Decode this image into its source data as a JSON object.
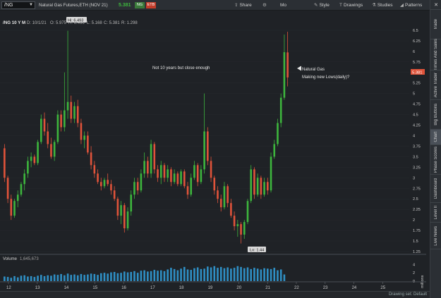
{
  "toolbar": {
    "symbol": "/NG",
    "description": "Natural Gas Futures,ETH (NOV 21)",
    "last_price": "5.381",
    "badge_ng": "NG",
    "badge_etb": "ETB",
    "buttons": [
      "Share",
      "Mo",
      "Style",
      "Drawings",
      "Studies",
      "Patterns"
    ]
  },
  "info": {
    "period": "/NG 10 Y M",
    "date": "D: 10/1/21",
    "open": "O: 5.975",
    "high": "H: 6.466",
    "low": "L: 5.168",
    "close": "C: 5.381",
    "range": "R: 1.298"
  },
  "annotations": {
    "hi_label": "Hi: 6.493",
    "lo_label": "Lo: 1.44",
    "note": "Not 10 years but close enough",
    "arrow_line1": "Natural Gas",
    "arrow_line2": "Making new Lows(daily)?",
    "price_tag": "5.381"
  },
  "price_axis": [
    "6.5",
    "6.25",
    "6",
    "5.75",
    "5.5",
    "5.25",
    "5",
    "4.75",
    "4.5",
    "4.25",
    "4",
    "3.75",
    "3.5",
    "3.25",
    "3",
    "2.75",
    "2.5",
    "2.25",
    "2",
    "1.75",
    "1.5",
    "1.25"
  ],
  "volume_panel": {
    "label": "Volume",
    "value": "1,645,673",
    "axis": [
      "4",
      "2",
      "0"
    ],
    "unit": "millions"
  },
  "time_axis": [
    "12",
    "13",
    "14",
    "15",
    "16",
    "17",
    "18",
    "19",
    "20",
    "21",
    "22",
    "23",
    "24",
    "25"
  ],
  "side_tabs": [
    "Trade",
    "Times And Sales",
    "Active Trader",
    "Big Buttons",
    "Chart",
    "Phase Scores",
    "Dashboard",
    "Level II",
    "Live News"
  ],
  "bottom": {
    "drawing_set": "Drawing set: Default"
  },
  "colors": {
    "up": "#3db53d",
    "down": "#e0533a",
    "background": "#1f2226",
    "price_tag": "#e0533a",
    "last_price": "#3db53d"
  },
  "chart_data": {
    "type": "candlestick",
    "price_range": [
      1.25,
      6.6
    ],
    "x_labels": [
      "12",
      "13",
      "14",
      "15",
      "16",
      "17",
      "18",
      "19",
      "20",
      "21",
      "22",
      "23",
      "24",
      "25"
    ],
    "bars": [
      {
        "o": 3.7,
        "h": 3.8,
        "l": 2.9,
        "c": 3.0
      },
      {
        "o": 3.0,
        "h": 3.05,
        "l": 2.4,
        "c": 2.5
      },
      {
        "o": 2.5,
        "h": 2.6,
        "l": 2.0,
        "c": 2.1
      },
      {
        "o": 2.1,
        "h": 2.5,
        "l": 2.05,
        "c": 2.45
      },
      {
        "o": 2.45,
        "h": 2.7,
        "l": 2.3,
        "c": 2.6
      },
      {
        "o": 2.6,
        "h": 2.9,
        "l": 2.55,
        "c": 2.85
      },
      {
        "o": 2.85,
        "h": 3.2,
        "l": 2.7,
        "c": 3.1
      },
      {
        "o": 3.1,
        "h": 3.5,
        "l": 3.0,
        "c": 3.4
      },
      {
        "o": 3.4,
        "h": 3.6,
        "l": 3.25,
        "c": 3.5
      },
      {
        "o": 3.5,
        "h": 3.55,
        "l": 3.3,
        "c": 3.35
      },
      {
        "o": 3.35,
        "h": 3.9,
        "l": 3.3,
        "c": 3.85
      },
      {
        "o": 3.85,
        "h": 4.5,
        "l": 3.8,
        "c": 4.4
      },
      {
        "o": 4.4,
        "h": 4.55,
        "l": 4.0,
        "c": 4.1
      },
      {
        "o": 4.1,
        "h": 4.3,
        "l": 3.7,
        "c": 3.8
      },
      {
        "o": 3.8,
        "h": 3.95,
        "l": 3.45,
        "c": 3.5
      },
      {
        "o": 3.5,
        "h": 3.9,
        "l": 3.4,
        "c": 3.85
      },
      {
        "o": 3.85,
        "h": 4.6,
        "l": 3.8,
        "c": 4.5
      },
      {
        "o": 4.5,
        "h": 4.6,
        "l": 4.1,
        "c": 4.2
      },
      {
        "o": 4.2,
        "h": 5.5,
        "l": 4.1,
        "c": 4.6
      },
      {
        "o": 4.6,
        "h": 6.49,
        "l": 4.4,
        "c": 4.8
      },
      {
        "o": 4.8,
        "h": 4.95,
        "l": 4.3,
        "c": 4.4
      },
      {
        "o": 4.4,
        "h": 4.8,
        "l": 4.3,
        "c": 4.7
      },
      {
        "o": 4.7,
        "h": 4.85,
        "l": 4.2,
        "c": 4.3
      },
      {
        "o": 4.3,
        "h": 4.4,
        "l": 3.8,
        "c": 3.9
      },
      {
        "o": 3.9,
        "h": 4.1,
        "l": 3.7,
        "c": 4.0
      },
      {
        "o": 4.0,
        "h": 4.1,
        "l": 3.55,
        "c": 3.6
      },
      {
        "o": 3.6,
        "h": 3.75,
        "l": 3.2,
        "c": 3.3
      },
      {
        "o": 3.3,
        "h": 3.4,
        "l": 3.0,
        "c": 3.1
      },
      {
        "o": 3.1,
        "h": 3.2,
        "l": 2.85,
        "c": 2.9
      },
      {
        "o": 2.9,
        "h": 3.0,
        "l": 2.7,
        "c": 2.8
      },
      {
        "o": 2.8,
        "h": 3.0,
        "l": 2.75,
        "c": 2.95
      },
      {
        "o": 2.95,
        "h": 3.1,
        "l": 2.8,
        "c": 2.85
      },
      {
        "o": 2.85,
        "h": 2.95,
        "l": 2.6,
        "c": 2.7
      },
      {
        "o": 2.7,
        "h": 2.8,
        "l": 2.45,
        "c": 2.5
      },
      {
        "o": 2.5,
        "h": 2.55,
        "l": 2.0,
        "c": 2.1
      },
      {
        "o": 2.1,
        "h": 2.45,
        "l": 1.9,
        "c": 2.35
      },
      {
        "o": 2.35,
        "h": 2.4,
        "l": 1.7,
        "c": 1.8
      },
      {
        "o": 1.8,
        "h": 2.3,
        "l": 1.75,
        "c": 2.2
      },
      {
        "o": 2.2,
        "h": 2.7,
        "l": 2.1,
        "c": 2.6
      },
      {
        "o": 2.6,
        "h": 3.0,
        "l": 2.5,
        "c": 2.9
      },
      {
        "o": 2.9,
        "h": 3.0,
        "l": 2.6,
        "c": 2.7
      },
      {
        "o": 2.7,
        "h": 3.2,
        "l": 2.65,
        "c": 3.1
      },
      {
        "o": 3.1,
        "h": 3.6,
        "l": 3.0,
        "c": 3.4
      },
      {
        "o": 3.4,
        "h": 3.5,
        "l": 3.0,
        "c": 3.1
      },
      {
        "o": 3.1,
        "h": 3.9,
        "l": 3.0,
        "c": 3.8
      },
      {
        "o": 3.8,
        "h": 3.85,
        "l": 3.1,
        "c": 3.2
      },
      {
        "o": 3.2,
        "h": 3.3,
        "l": 2.9,
        "c": 3.0
      },
      {
        "o": 3.0,
        "h": 3.4,
        "l": 2.85,
        "c": 3.3
      },
      {
        "o": 3.3,
        "h": 3.35,
        "l": 2.9,
        "c": 3.0
      },
      {
        "o": 3.0,
        "h": 3.3,
        "l": 2.9,
        "c": 3.2
      },
      {
        "o": 3.2,
        "h": 3.25,
        "l": 2.8,
        "c": 2.9
      },
      {
        "o": 2.9,
        "h": 3.2,
        "l": 2.85,
        "c": 3.1
      },
      {
        "o": 3.1,
        "h": 3.15,
        "l": 2.8,
        "c": 2.85
      },
      {
        "o": 2.85,
        "h": 3.2,
        "l": 2.8,
        "c": 3.15
      },
      {
        "o": 3.15,
        "h": 3.2,
        "l": 2.75,
        "c": 2.8
      },
      {
        "o": 2.8,
        "h": 2.9,
        "l": 2.5,
        "c": 2.6
      },
      {
        "o": 2.6,
        "h": 3.1,
        "l": 2.55,
        "c": 3.0
      },
      {
        "o": 3.0,
        "h": 3.4,
        "l": 2.95,
        "c": 3.3
      },
      {
        "o": 3.3,
        "h": 3.35,
        "l": 2.8,
        "c": 2.9
      },
      {
        "o": 2.9,
        "h": 3.3,
        "l": 2.85,
        "c": 3.2
      },
      {
        "o": 3.2,
        "h": 5.0,
        "l": 3.1,
        "c": 4.1
      },
      {
        "o": 4.1,
        "h": 4.2,
        "l": 3.3,
        "c": 3.4
      },
      {
        "o": 3.4,
        "h": 3.5,
        "l": 2.9,
        "c": 3.0
      },
      {
        "o": 3.0,
        "h": 3.05,
        "l": 2.6,
        "c": 2.7
      },
      {
        "o": 2.7,
        "h": 2.8,
        "l": 2.4,
        "c": 2.5
      },
      {
        "o": 2.5,
        "h": 2.6,
        "l": 2.2,
        "c": 2.3
      },
      {
        "o": 2.3,
        "h": 2.9,
        "l": 2.25,
        "c": 2.8
      },
      {
        "o": 2.8,
        "h": 2.85,
        "l": 2.3,
        "c": 2.4
      },
      {
        "o": 2.4,
        "h": 2.5,
        "l": 2.05,
        "c": 2.1
      },
      {
        "o": 2.1,
        "h": 2.2,
        "l": 1.75,
        "c": 1.85
      },
      {
        "o": 1.85,
        "h": 2.0,
        "l": 1.6,
        "c": 1.9
      },
      {
        "o": 1.9,
        "h": 1.95,
        "l": 1.44,
        "c": 1.65
      },
      {
        "o": 1.65,
        "h": 2.0,
        "l": 1.55,
        "c": 1.95
      },
      {
        "o": 1.95,
        "h": 2.5,
        "l": 1.9,
        "c": 2.45
      },
      {
        "o": 2.45,
        "h": 3.3,
        "l": 2.4,
        "c": 3.2
      },
      {
        "o": 3.2,
        "h": 3.25,
        "l": 2.5,
        "c": 2.6
      },
      {
        "o": 2.6,
        "h": 3.1,
        "l": 2.55,
        "c": 3.0
      },
      {
        "o": 3.0,
        "h": 3.05,
        "l": 2.5,
        "c": 2.6
      },
      {
        "o": 2.6,
        "h": 3.0,
        "l": 2.55,
        "c": 2.9
      },
      {
        "o": 2.9,
        "h": 3.0,
        "l": 2.6,
        "c": 2.7
      },
      {
        "o": 2.7,
        "h": 3.6,
        "l": 2.65,
        "c": 3.5
      },
      {
        "o": 3.5,
        "h": 3.9,
        "l": 3.45,
        "c": 3.8
      },
      {
        "o": 3.8,
        "h": 4.4,
        "l": 3.75,
        "c": 4.3
      },
      {
        "o": 4.3,
        "h": 5.0,
        "l": 4.2,
        "c": 4.9
      },
      {
        "o": 4.9,
        "h": 6.4,
        "l": 4.85,
        "c": 5.98
      },
      {
        "o": 5.975,
        "h": 6.466,
        "l": 5.168,
        "c": 5.381
      }
    ],
    "volume_millions": [
      1.1,
      1.0,
      0.8,
      1.2,
      0.9,
      1.3,
      1.4,
      1.1,
      1.2,
      1.0,
      1.3,
      1.5,
      1.2,
      1.4,
      1.3,
      1.6,
      1.5,
      1.7,
      1.4,
      1.8,
      1.5,
      1.6,
      1.4,
      1.7,
      1.5,
      1.6,
      1.8,
      1.7,
      1.5,
      1.9,
      2.0,
      1.8,
      2.1,
      2.2,
      1.9,
      2.0,
      2.3,
      2.1,
      2.2,
      2.4,
      2.0,
      2.5,
      2.6,
      2.3,
      2.4,
      2.7,
      2.5,
      2.6,
      2.4,
      2.8,
      3.2,
      2.9,
      2.6,
      3.0,
      3.4,
      2.8,
      2.7,
      3.1,
      3.3,
      2.9,
      3.0,
      3.5,
      3.3,
      3.6,
      3.2,
      3.4,
      3.1,
      3.3,
      3.0,
      3.2,
      3.6,
      3.4,
      3.1,
      3.3,
      2.9,
      3.2,
      3.0,
      2.8,
      3.1,
      3.0,
      2.9,
      3.2,
      2.6,
      2.8,
      1.6
    ]
  }
}
